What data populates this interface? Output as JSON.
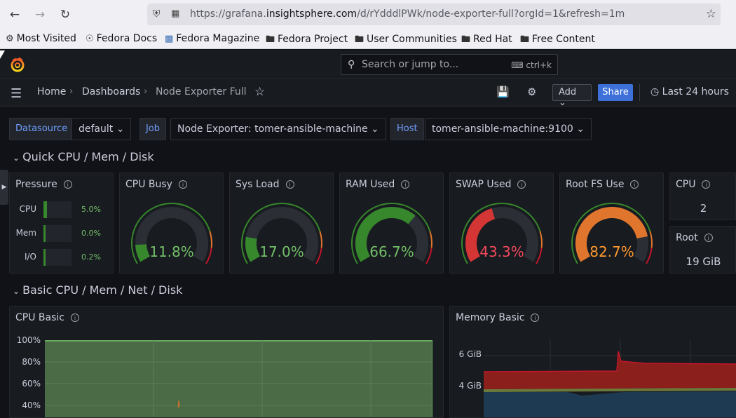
{
  "browser": {
    "url_prefix": "https://grafana.",
    "url_domain": "insightsphere.com",
    "url_path": "/d/rYdddlPWk/node-exporter-full?orgId=1&refresh=1m",
    "bookmarks": [
      "Most Visited",
      "Fedora Docs",
      "Fedora Magazine",
      "Fedora Project",
      "User Communities",
      "Red Hat",
      "Free Content"
    ]
  },
  "topbar": {
    "search_placeholder": "Search or jump to...",
    "shortcut": "ctrl+k"
  },
  "toolbar": {
    "breadcrumb": [
      "Home",
      "Dashboards",
      "Node Exporter Full"
    ],
    "add_label": "Add",
    "share_label": "Share",
    "time_range": "Last 24 hours"
  },
  "variables": [
    {
      "label": "Datasource",
      "value": "default"
    },
    {
      "label": "Job",
      "value": "Node Exporter: tomer-ansible-machine"
    },
    {
      "label": "Host",
      "value": "tomer-ansible-machine:9100"
    }
  ],
  "rows": {
    "quick": "Quick CPU / Mem / Disk",
    "basic": "Basic CPU / Mem / Net / Disk"
  },
  "pressure": {
    "title": "Pressure",
    "items": [
      {
        "label": "CPU",
        "value": "5.0%",
        "fraction": 0.05
      },
      {
        "label": "Mem",
        "value": "0.0%",
        "fraction": 0.0
      },
      {
        "label": "I/O",
        "value": "0.2%",
        "fraction": 0.002
      }
    ]
  },
  "gauges": [
    {
      "title": "CPU Busy",
      "value": "11.8%",
      "percent": 11.8,
      "color": "#37872d",
      "text_color": "#73bf69"
    },
    {
      "title": "Sys Load",
      "value": "17.0%",
      "percent": 17.0,
      "color": "#37872d",
      "text_color": "#73bf69"
    },
    {
      "title": "RAM Used",
      "value": "66.7%",
      "percent": 66.7,
      "color": "#37872d",
      "text_color": "#73bf69"
    },
    {
      "title": "SWAP Used",
      "value": "43.3%",
      "percent": 43.3,
      "color": "#d43535",
      "text_color": "#f2495c"
    },
    {
      "title": "Root FS Use",
      "value": "82.7%",
      "percent": 82.7,
      "color": "#e0752d",
      "text_color": "#ff9830"
    }
  ],
  "stats": [
    {
      "title": "CPU",
      "value": "2"
    },
    {
      "title": "Root",
      "value": "19 GiB"
    }
  ],
  "cpu_basic": {
    "title": "CPU Basic",
    "y_ticks": [
      "100%",
      "80%",
      "60%",
      "40%"
    ]
  },
  "memory_basic": {
    "title": "Memory Basic",
    "y_ticks": [
      "6 GiB",
      "4 GiB"
    ]
  },
  "colors": {
    "green": "#37872d",
    "red": "#c4162a",
    "orange": "#e0752d",
    "blue": "#3d71d9"
  }
}
